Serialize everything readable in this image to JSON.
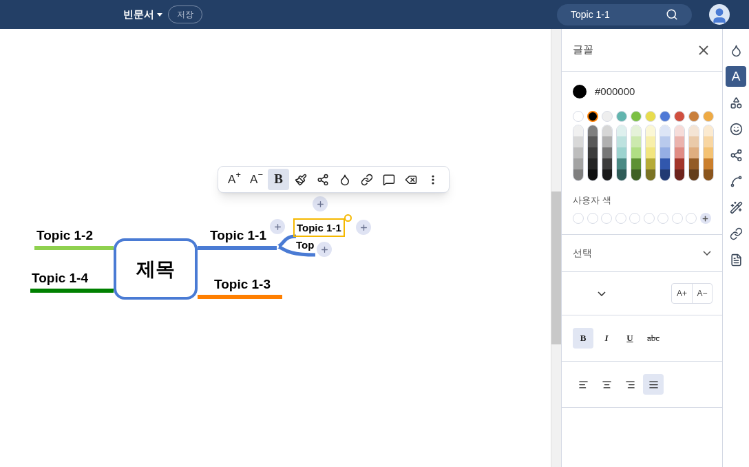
{
  "header": {
    "doc_title": "빈문서",
    "save_button": "저장",
    "search": {
      "value": "Topic 1-1"
    }
  },
  "toolbar": [
    {
      "kind": "font-up",
      "label": "A$^{+}$",
      "selected": false
    },
    {
      "kind": "font-down",
      "label": "A$^{−}$",
      "selected": false
    },
    {
      "kind": "bold",
      "label": "B",
      "selected": true
    },
    {
      "kind": "brush",
      "selected": false
    },
    {
      "kind": "branch",
      "selected": false
    },
    {
      "kind": "fill",
      "selected": false
    },
    {
      "kind": "link",
      "selected": false
    },
    {
      "kind": "comment",
      "selected": false
    },
    {
      "kind": "delete",
      "selected": false
    },
    {
      "kind": "more",
      "selected": false
    }
  ],
  "mindmap": {
    "root": "제목",
    "topics": [
      {
        "label": "Topic 1-2",
        "color": "#8fd14f"
      },
      {
        "label": "Topic 1-1",
        "color": "#4a7bd4"
      },
      {
        "label": "Topic 1-4",
        "color": "#008000"
      },
      {
        "label": "Topic 1-3",
        "color": "#ff7f00"
      }
    ],
    "subtopics": [
      {
        "label": "Topic 1-1",
        "selected": true
      },
      {
        "label": "Top",
        "selected": false
      }
    ]
  },
  "panel": {
    "title": "글꼴",
    "current_color": {
      "value": "#000000",
      "color": "#000000"
    },
    "swatches": [
      {
        "color": "#ffffff",
        "selected": false
      },
      {
        "color": "#000000",
        "selected": true
      },
      {
        "color": "#eeeeee",
        "selected": false
      },
      {
        "color": "#62b5ae",
        "selected": false
      },
      {
        "color": "#7bc043",
        "selected": false
      },
      {
        "color": "#e8dc4e",
        "selected": false
      },
      {
        "color": "#4f79d6",
        "selected": false
      },
      {
        "color": "#d04f3f",
        "selected": false
      },
      {
        "color": "#c97f3b",
        "selected": false
      },
      {
        "color": "#eeaa44",
        "selected": false
      }
    ],
    "custom_colors_label": "사용자 색",
    "font_select": "선택",
    "size_buttons": [
      "A+",
      "A−"
    ],
    "styles": [
      {
        "kind": "bold",
        "label": "B",
        "selected": true
      },
      {
        "kind": "italic",
        "label": "I",
        "selected": false
      },
      {
        "kind": "underline",
        "label": "U",
        "selected": false
      },
      {
        "kind": "strike",
        "label": "abc",
        "selected": false
      }
    ],
    "aligns": [
      {
        "kind": "left",
        "selected": false
      },
      {
        "kind": "center",
        "selected": false
      },
      {
        "kind": "right",
        "selected": false
      },
      {
        "kind": "justify",
        "selected": true
      }
    ]
  },
  "rail": [
    {
      "kind": "fill",
      "selected": false
    },
    {
      "kind": "font",
      "label": "A",
      "selected": true
    },
    {
      "kind": "shape",
      "selected": false
    },
    {
      "kind": "emoji",
      "selected": false
    },
    {
      "kind": "structure",
      "selected": false
    },
    {
      "kind": "connector",
      "selected": false
    },
    {
      "kind": "magic",
      "selected": false
    },
    {
      "kind": "link",
      "selected": false
    },
    {
      "kind": "note",
      "selected": false
    }
  ]
}
